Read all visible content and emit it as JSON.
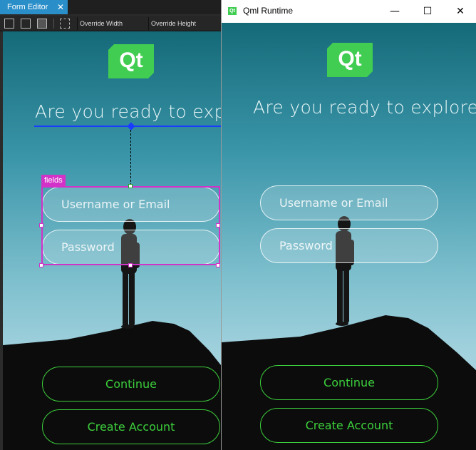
{
  "editor": {
    "tab_label": "Form Editor",
    "tab_close": "✕",
    "toolbar": {
      "override_width": "Override Width",
      "override_height": "Override Height"
    },
    "selection_label": "fields"
  },
  "runtime": {
    "window_title": "Qml Runtime",
    "minimize": "—",
    "maximize": "☐",
    "close": "✕"
  },
  "app": {
    "logo_text": "Qt",
    "headline": "Are you ready to explore?",
    "username_placeholder": "Username or Email",
    "password_placeholder": "Password",
    "continue_label": "Continue",
    "create_account_label": "Create Account"
  },
  "colors": {
    "accent_green": "#3ccf3c",
    "qt_green": "#41cd52",
    "selection_magenta": "#d232c8",
    "anchor_blue": "#1a3cff",
    "tab_blue": "#2a8ec8"
  }
}
